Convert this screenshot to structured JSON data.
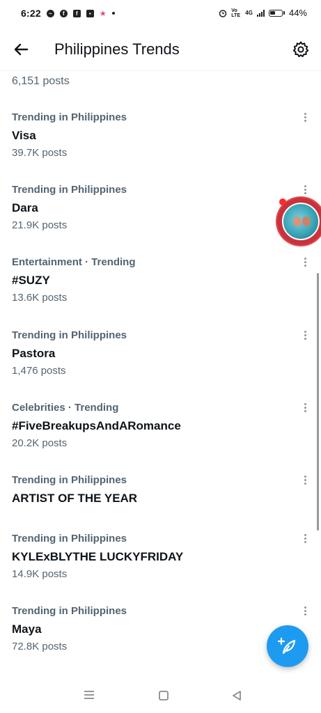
{
  "status_bar": {
    "time": "6:22",
    "app_icons": [
      "messenger-icon",
      "facebook-icon",
      "facebook-icon",
      "bag-icon",
      "star-icon",
      "dot-icon"
    ],
    "right_icons": [
      "alarm-icon",
      "volte-icon",
      "4g-signal-icon",
      "signal-icon",
      "battery-icon"
    ],
    "volte_label": "Vo LTE",
    "network_label": "4G",
    "battery_text": "44%"
  },
  "header": {
    "title": "Philippines Trends",
    "back_icon": "arrow-left-icon",
    "settings_icon": "gear-icon"
  },
  "feed": {
    "partial_item": {
      "count": "6,151 posts"
    },
    "trends": [
      {
        "meta": "Trending in Philippines",
        "name": "Visa",
        "count": "39.7K posts"
      },
      {
        "meta": "Trending in Philippines",
        "name": "Dara",
        "count": "21.9K posts"
      },
      {
        "meta": "Entertainment · Trending",
        "name": "#SUZY",
        "count": "13.6K posts"
      },
      {
        "meta": "Trending in Philippines",
        "name": "Pastora",
        "count": "1,476 posts"
      },
      {
        "meta": "Celebrities · Trending",
        "name": "#FiveBreakupsAndARomance",
        "count": "20.2K posts"
      },
      {
        "meta": "Trending in Philippines",
        "name": "ARTIST OF THE YEAR",
        "count": ""
      },
      {
        "meta": "Trending in Philippines",
        "name": "KYLExBLYTHE LUCKYFRIDAY",
        "count": "14.9K posts"
      },
      {
        "meta": "Trending in Philippines",
        "name": "Maya",
        "count": "72.8K posts"
      }
    ]
  },
  "fab": {
    "icon": "compose-post-icon",
    "color": "#1d9bf0"
  },
  "nav_bar": {
    "icons": [
      "recent-apps-icon",
      "home-icon",
      "back-icon"
    ]
  },
  "colors": {
    "text_primary": "#0f1419",
    "text_secondary": "#536471",
    "accent": "#1d9bf0"
  }
}
